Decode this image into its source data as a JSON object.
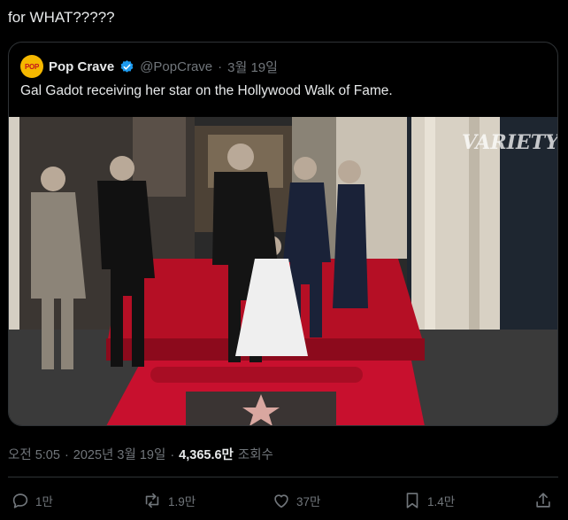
{
  "tweet": {
    "text": "for WHAT?????"
  },
  "quote": {
    "avatar_text": "POP",
    "author_name": "Pop Crave",
    "handle": "@PopCrave",
    "separator": "·",
    "date": "3월 19일",
    "text": "Gal Gadot receiving her star on the Hollywood Walk of Fame.",
    "watermark": "VARIETY"
  },
  "meta": {
    "time": "오전 5:05",
    "separator": "·",
    "date": "2025년 3월 19일",
    "separator2": "·",
    "views": "4,365.6만",
    "views_label": "조회수"
  },
  "actions": {
    "reply_count": "1만",
    "retweet_count": "1.9만",
    "like_count": "37만",
    "bookmark_count": "1.4만"
  },
  "colors": {
    "background": "#000000",
    "text": "#e7e9ea",
    "muted": "#71767b",
    "border": "#2f3336",
    "verified": "#1d9bf0",
    "carpet": "#c8102e"
  },
  "icons": [
    "verified-badge-icon",
    "reply-icon",
    "retweet-icon",
    "like-icon",
    "bookmark-icon",
    "share-icon"
  ]
}
